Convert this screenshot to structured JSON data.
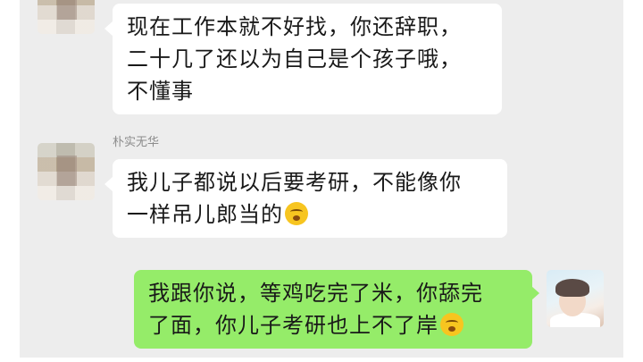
{
  "messages": [
    {
      "direction": "incoming",
      "sender": "",
      "lines": [
        "现在工作本就不好找，你还辞职，",
        "二十几了还以为自己是个孩子哦，",
        "不懂事"
      ],
      "emoji": ""
    },
    {
      "direction": "incoming",
      "sender": "朴实无华",
      "lines": [
        "我儿子都说以后要考研，不能像你",
        "一样吊儿郎当的"
      ],
      "emoji": "grinning-face-emoji"
    },
    {
      "direction": "outgoing",
      "sender": "",
      "lines": [
        "我跟你说，等鸡吃完了米，你舔完",
        "了面，你儿子考研也上不了岸"
      ],
      "emoji": "grinning-face-emoji"
    }
  ],
  "colors": {
    "background": "#ededed",
    "incoming_bubble": "#ffffff",
    "outgoing_bubble": "#95ec69",
    "sender_name": "#8c8c8c"
  }
}
